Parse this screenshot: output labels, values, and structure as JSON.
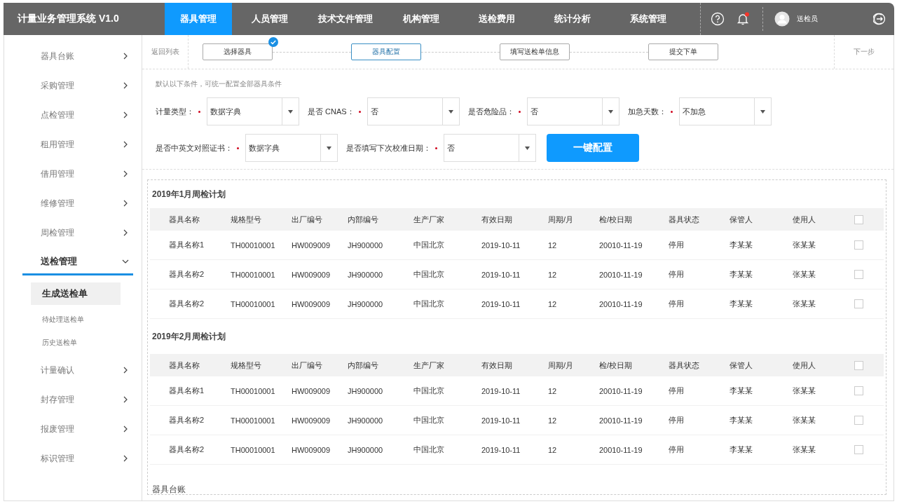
{
  "header": {
    "title": "计量业务管理系统 V1.0",
    "nav": [
      {
        "label": "器具管理",
        "selected": true
      },
      {
        "label": "人员管理",
        "selected": false
      },
      {
        "label": "技术文件管理",
        "selected": false
      },
      {
        "label": "机构管理",
        "selected": false
      },
      {
        "label": "送检费用",
        "selected": false
      },
      {
        "label": "统计分析",
        "selected": false
      },
      {
        "label": "系统管理",
        "selected": false
      }
    ],
    "unread_notifications": true,
    "user": "送检员"
  },
  "sidebar": {
    "items": [
      {
        "label": "器具台账",
        "selected": false,
        "expanded": false
      },
      {
        "label": "采购管理",
        "selected": false,
        "expanded": false
      },
      {
        "label": "点检管理",
        "selected": false,
        "expanded": false
      },
      {
        "label": "租用管理",
        "selected": false,
        "expanded": false
      },
      {
        "label": "借用管理",
        "selected": false,
        "expanded": false
      },
      {
        "label": "维修管理",
        "selected": false,
        "expanded": false
      },
      {
        "label": "周检管理",
        "selected": false,
        "expanded": false
      },
      {
        "label": "送检管理",
        "selected": true,
        "expanded": true,
        "children": [
          {
            "label": "生成送检单",
            "selected": true
          },
          {
            "label": "待处理送检单",
            "selected": false
          },
          {
            "label": "历史送检单",
            "selected": false
          }
        ]
      },
      {
        "label": "计量确认",
        "selected": false,
        "expanded": false
      },
      {
        "label": "封存管理",
        "selected": false,
        "expanded": false
      },
      {
        "label": "报废管理",
        "selected": false,
        "expanded": false
      },
      {
        "label": "标识管理",
        "selected": false,
        "expanded": false
      }
    ]
  },
  "toolbar": {
    "back": "返回列表",
    "next": "下一步"
  },
  "steps": [
    {
      "label": "选择器具",
      "done": true,
      "selected": false
    },
    {
      "label": "器具配置",
      "done": false,
      "selected": true
    },
    {
      "label": "填写送检单信息",
      "done": false,
      "selected": false
    },
    {
      "label": "提交下单",
      "done": false,
      "selected": false
    }
  ],
  "form": {
    "hint": "默认以下条件，可统一配置全部器具条件",
    "rows": [
      [
        {
          "label": "计量类型：",
          "required": true,
          "value": "数据字典"
        },
        {
          "label": "是否 CNAS：",
          "required": true,
          "value": "否"
        },
        {
          "label": "是否危险品：",
          "required": true,
          "value": "否"
        },
        {
          "label": "加急天数：",
          "required": true,
          "value": "不加急"
        }
      ],
      [
        {
          "label": "是否中英文对照证书：",
          "required": true,
          "value": "数据字典"
        },
        {
          "label": "是否填写下次校准日期：",
          "required": true,
          "value": "否"
        }
      ]
    ],
    "submit": "一键配置"
  },
  "plans": [
    {
      "title": "2019年1月周检计划",
      "columns": [
        "器具名称",
        "规格型号",
        "出厂编号",
        "内部编号",
        "生产厂家",
        "有效日期",
        "周期/月",
        "检/校日期",
        "器具状态",
        "保管人",
        "使用人"
      ],
      "all_checked": false,
      "rows": [
        {
          "cells": [
            "器具名称1",
            "TH00010001",
            "HW009009",
            "JH900000",
            "中国北京",
            "2019-10-11",
            "12",
            "20010-11-19",
            "停用",
            "李某某",
            "张某某"
          ],
          "checked": false
        },
        {
          "cells": [
            "器具名称2",
            "TH00010001",
            "HW009009",
            "JH900000",
            "中国北京",
            "2019-10-11",
            "12",
            "20010-11-19",
            "停用",
            "李某某",
            "张某某"
          ],
          "checked": false
        },
        {
          "cells": [
            "器具名称2",
            "TH00010001",
            "HW009009",
            "JH900000",
            "中国北京",
            "2019-10-11",
            "12",
            "20010-11-19",
            "停用",
            "李某某",
            "张某某"
          ],
          "checked": false
        }
      ]
    },
    {
      "title": "2019年2月周检计划",
      "columns": [
        "器具名称",
        "规格型号",
        "出厂编号",
        "内部编号",
        "生产厂家",
        "有效日期",
        "周期/月",
        "检/校日期",
        "器具状态",
        "保管人",
        "使用人"
      ],
      "all_checked": false,
      "rows": [
        {
          "cells": [
            "器具名称1",
            "TH00010001",
            "HW009009",
            "JH900000",
            "中国北京",
            "2019-10-11",
            "12",
            "20010-11-19",
            "停用",
            "李某某",
            "张某某"
          ],
          "checked": false
        },
        {
          "cells": [
            "器具名称2",
            "TH00010001",
            "HW009009",
            "JH900000",
            "中国北京",
            "2019-10-11",
            "12",
            "20010-11-19",
            "停用",
            "李某某",
            "张某某"
          ],
          "checked": false
        },
        {
          "cells": [
            "器具名称2",
            "TH00010001",
            "HW009009",
            "JH900000",
            "中国北京",
            "2019-10-11",
            "12",
            "20010-11-19",
            "停用",
            "李某某",
            "张某某"
          ],
          "checked": false
        }
      ]
    }
  ],
  "next_section": {
    "title": "器具台账"
  }
}
